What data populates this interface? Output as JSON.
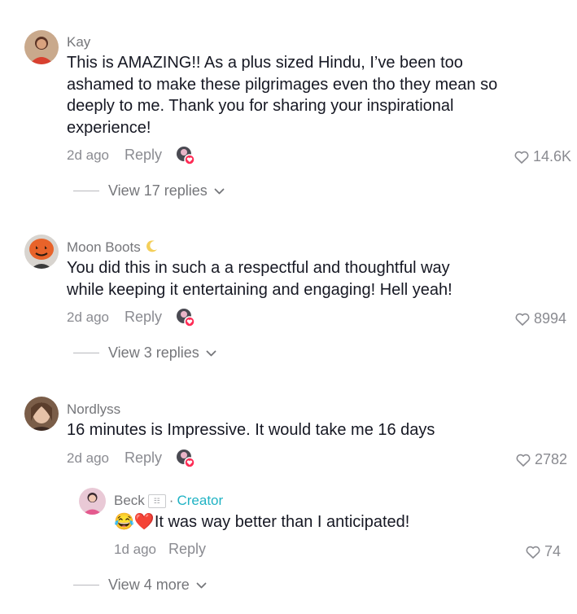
{
  "comments": [
    {
      "username": "Kay",
      "text": "This is AMAZING!! As a plus sized Hindu, I’ve been too ashamed to make these pilgrimages even tho they mean so deeply to me. Thank you for sharing your inspirational experience!",
      "time": "2d ago",
      "reply_label": "Reply",
      "likes": "14.6K",
      "view_replies": "View 17 replies"
    },
    {
      "username": "Moon Boots",
      "text": "You did this in such a a respectful and thoughtful way while keeping it entertaining and engaging! Hell yeah!",
      "time": "2d ago",
      "reply_label": "Reply",
      "likes": "8994",
      "view_replies": "View 3 replies"
    },
    {
      "username": "Nordlyss",
      "text": "16 minutes is Impressive. It would take me 16 days",
      "time": "2d ago",
      "reply_label": "Reply",
      "likes": "2782",
      "reply": {
        "username": "Beck",
        "creator_label": "Creator",
        "text": "It was way better than I anticipated!",
        "emoji": "😂❤️",
        "time": "1d ago",
        "reply_label": "Reply",
        "likes": "74"
      },
      "view_more": "View 4 more"
    }
  ],
  "colors": {
    "text": "#161823",
    "muted": "#8a8b91",
    "creator": "#20b3c4",
    "liked_badge": "#fe2c55"
  },
  "icons": {
    "like": "heart-outline-icon",
    "expand": "chevron-down-icon",
    "creator_liked": "creator-liked-heart-icon"
  }
}
